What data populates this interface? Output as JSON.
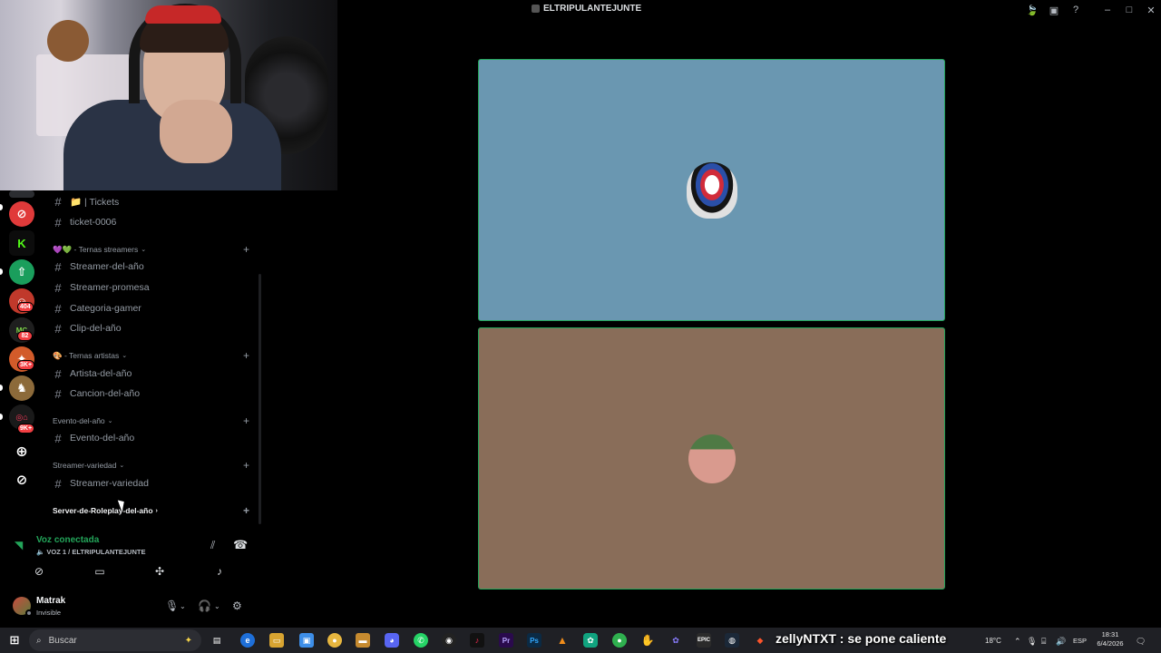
{
  "window": {
    "title": "ELTRIPULANTEJUNTE"
  },
  "rail": {
    "badges": [
      "404",
      "82",
      "3K+",
      "9K+"
    ]
  },
  "channels": {
    "items": [
      {
        "type": "channel",
        "label": "📁 | Tickets"
      },
      {
        "type": "channel",
        "label": "ticket-0006"
      },
      {
        "type": "category",
        "label": "💜💚 - Ternas streamers"
      },
      {
        "type": "channel",
        "label": "Streamer-del-año"
      },
      {
        "type": "channel",
        "label": "Streamer-promesa"
      },
      {
        "type": "channel",
        "label": "Categoria-gamer"
      },
      {
        "type": "channel",
        "label": "Clip-del-año"
      },
      {
        "type": "category",
        "label": "🎨 - Ternas artistas"
      },
      {
        "type": "channel",
        "label": "Artista-del-año"
      },
      {
        "type": "channel",
        "label": "Cancion-del-año"
      },
      {
        "type": "category",
        "label": "Evento-del-año"
      },
      {
        "type": "channel",
        "label": "Evento-del-año"
      },
      {
        "type": "category",
        "label": "Streamer-variedad"
      },
      {
        "type": "channel",
        "label": "Streamer-variedad"
      },
      {
        "type": "category",
        "label": "Server-de-Roleplay-del-año"
      }
    ]
  },
  "voice": {
    "status": "Voz conectada",
    "channel": "🔈 VOZ 1 / ELTRIPULANTEJUNTE"
  },
  "user": {
    "name": "Matrak",
    "status": "Invisible"
  },
  "taskbar": {
    "search_placeholder": "Buscar",
    "overlay_message": "zellyNTXT : se pone caliente",
    "temperature": "18°C",
    "language": "ESP",
    "time": "18:31",
    "date": "6/4/2026"
  },
  "colors": {
    "accent_green": "#23a55a",
    "tile_1_bg": "#6a97b1",
    "tile_2_bg": "#896d59",
    "badge_red": "#f23f43"
  }
}
